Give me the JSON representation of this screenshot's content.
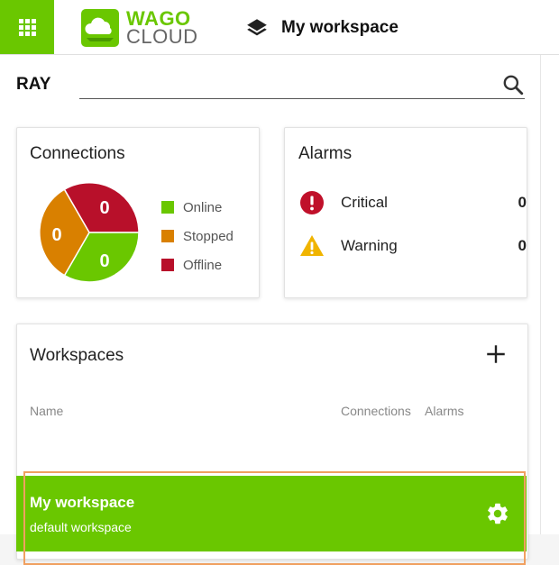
{
  "header": {
    "logo_top": "WAGO",
    "logo_bottom": "CLOUD",
    "workspace_title": "My workspace"
  },
  "user": {
    "name": "RAY"
  },
  "search": {
    "placeholder": ""
  },
  "connections": {
    "title": "Connections",
    "legend": [
      {
        "label": "Online",
        "color": "#6ac700"
      },
      {
        "label": "Stopped",
        "color": "#d98000"
      },
      {
        "label": "Offline",
        "color": "#b8102a"
      }
    ],
    "pie_labels": {
      "offline": "0",
      "stopped": "0",
      "online": "0"
    }
  },
  "alarms": {
    "title": "Alarms",
    "items": [
      {
        "label": "Critical",
        "count": "0",
        "icon": "critical-icon",
        "color": "#c0102a"
      },
      {
        "label": "Warning",
        "count": "0",
        "icon": "warning-icon",
        "color": "#f0b400"
      }
    ]
  },
  "workspaces": {
    "title": "Workspaces",
    "columns": {
      "name": "Name",
      "connections": "Connections",
      "alarms": "Alarms"
    },
    "rows": [
      {
        "name": "My workspace",
        "description": "default workspace"
      }
    ]
  }
}
